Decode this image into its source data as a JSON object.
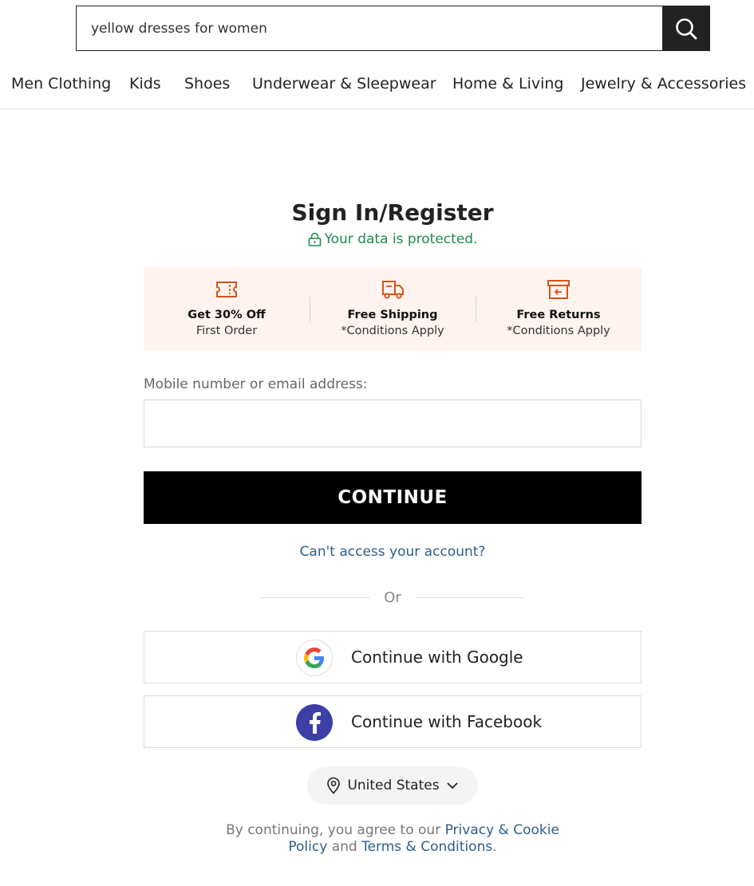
{
  "search": {
    "value": "yellow dresses for women",
    "button_icon": "search-icon"
  },
  "nav": {
    "items": [
      {
        "label": "Men Clothing"
      },
      {
        "label": "Kids"
      },
      {
        "label": "Shoes"
      },
      {
        "label": "Underwear & Sleepwear"
      },
      {
        "label": "Home & Living"
      },
      {
        "label": "Jewelry & Accessories"
      }
    ]
  },
  "signin": {
    "title": "Sign In/Register",
    "protected_text": "Your data is protected.",
    "benefits": [
      {
        "icon": "coupon-icon",
        "title": "Get 30% Off",
        "subtitle": "First Order"
      },
      {
        "icon": "truck-icon",
        "title": "Free Shipping",
        "subtitle": "*Conditions Apply"
      },
      {
        "icon": "return-box-icon",
        "title": "Free Returns",
        "subtitle": "*Conditions Apply"
      }
    ],
    "field_label": "Mobile number or email address:",
    "field_value": "",
    "continue_label": "CONTINUE",
    "cant_access": "Can't access your account?",
    "or_text": "Or",
    "google_label": "Continue with Google",
    "facebook_label": "Continue with Facebook",
    "country": "United States",
    "legal": {
      "prefix": "By continuing, you agree to our ",
      "privacy_a": "Privacy & Cookie",
      "privacy_b": "Policy",
      "and": " and ",
      "terms": "Terms & Conditions",
      "suffix": "."
    }
  },
  "colors": {
    "accent_orange": "#d4541a",
    "protected_green": "#1e8a4c",
    "link_blue": "#2d5d8c",
    "facebook_blue": "#3b3fa6",
    "benefit_bg": "#fff3ef"
  }
}
